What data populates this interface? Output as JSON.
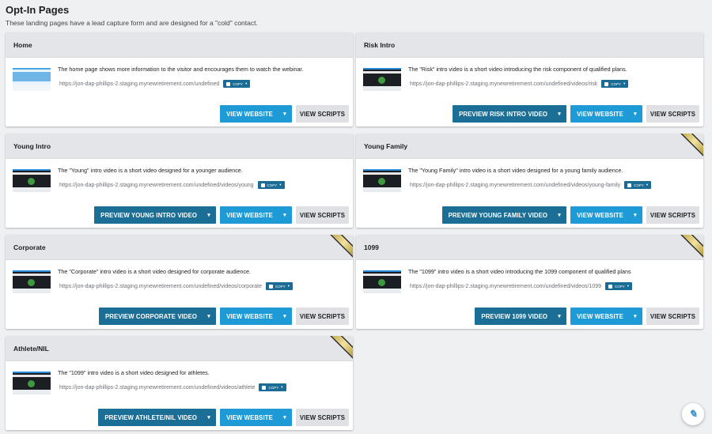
{
  "page": {
    "title": "Opt-In Pages",
    "subtitle": "These landing pages have a lead capture form and are designed for a \"cold\" contact."
  },
  "buttons": {
    "copy": "COPY",
    "view_website": "VIEW WEBSITE",
    "view_scripts": "VIEW SCRIPTS",
    "caret": "▾"
  },
  "cards": [
    {
      "title": "Home",
      "description": "The home page shows more information to the visitor and encourages them to watch the webinar.",
      "url": "https://jon-dap-phillips-2.staging.mynewretirement.com/undefined",
      "preview_label": ""
    },
    {
      "title": "Risk Intro",
      "description": "The \"Risk\" intro video is a short video introducing the risk component of qualified plans.",
      "url": "https://jon-dap-phillips-2.staging.mynewretirement.com/undefined/videos/risk",
      "preview_label": "PREVIEW RISK INTRO VIDEO"
    },
    {
      "title": "Young Intro",
      "description": "The \"Young\" intro video is a short video designed for a younger audience.",
      "url": "https://jon-dap-phillips-2.staging.mynewretirement.com/undefined/videos/young",
      "preview_label": "PREVIEW YOUNG INTRO VIDEO"
    },
    {
      "title": "Young Family",
      "description": "The \"Young Family\" intro video is a short video designed for a young family audience.",
      "url": "https://jon-dap-phillips-2.staging.mynewretirement.com/undefined/videos/young-family",
      "preview_label": "PREVIEW YOUNG FAMILY VIDEO"
    },
    {
      "title": "Corporate",
      "description": "The \"Corporate\" intro video is a short video designed for corporate audience.",
      "url": "https://jon-dap-phillips-2.staging.mynewretirement.com/undefined/videos/corporate",
      "preview_label": "PREVIEW CORPORATE VIDEO"
    },
    {
      "title": "1099",
      "description": "The \"1099\" intro video is a short video introducing the 1099 component of qualified plans",
      "url": "https://jon-dap-phillips-2.staging.mynewretirement.com/undefined/videos/1099",
      "preview_label": "PREVIEW 1099 VIDEO"
    },
    {
      "title": "Athlete/NIL",
      "description": "The \"1099\" intro video is a short video designed for athletes.",
      "url": "https://jon-dap-phillips-2.staging.mynewretirement.com/undefined/videos/athlete",
      "preview_label": "PREVIEW ATHLETE/NIL VIDEO"
    }
  ],
  "colors": {
    "primary_dark": "#1b6e95",
    "primary_light": "#1e9bd7",
    "header_bg": "#e3e5e8"
  },
  "icons": {
    "copy": "clipboard-icon",
    "dropdown": "chevron-down-icon",
    "ribbon": "gold-ribbon-icon",
    "fab": "feather-icon"
  }
}
